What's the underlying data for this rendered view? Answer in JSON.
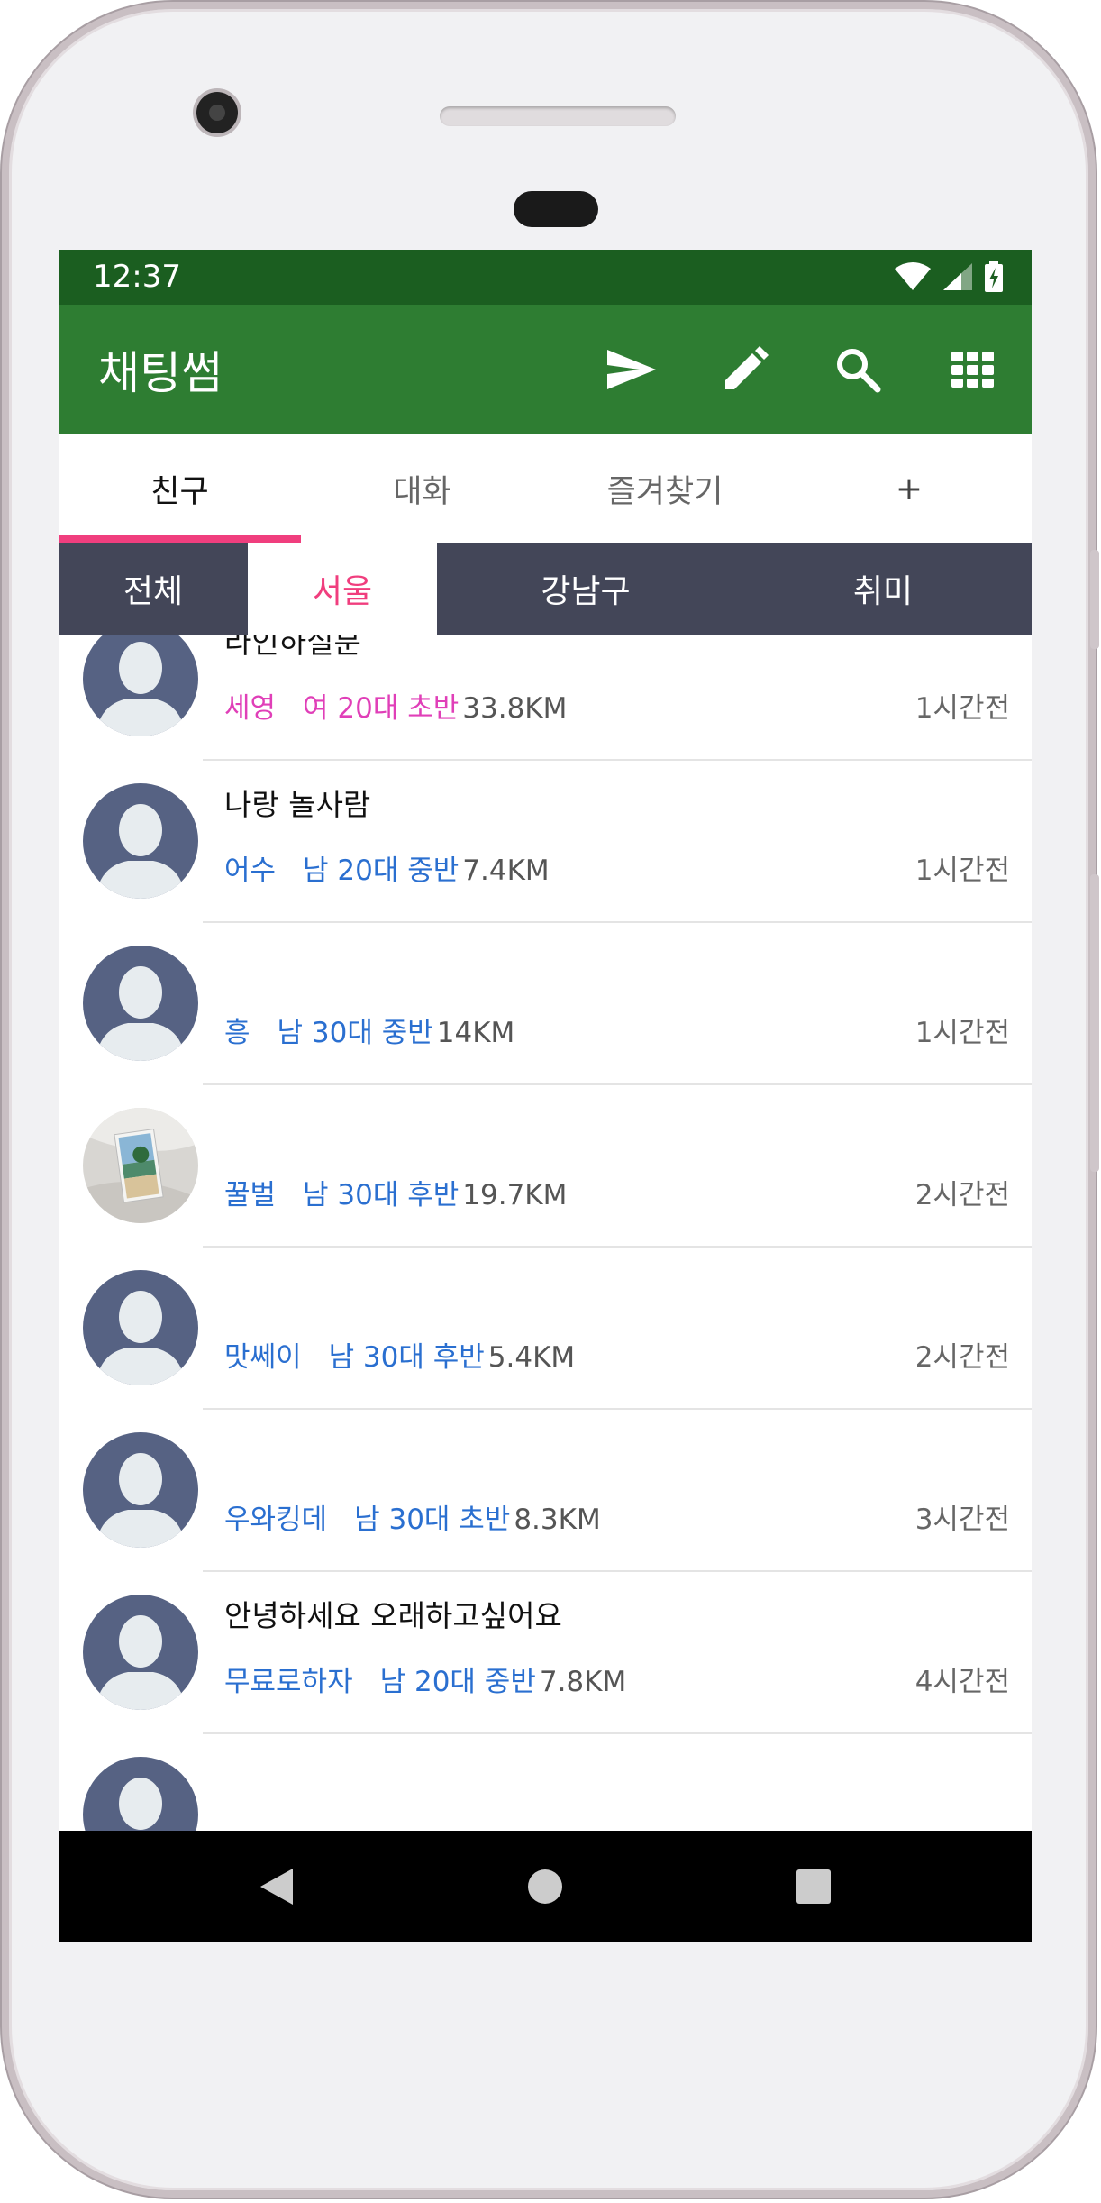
{
  "status_bar": {
    "time": "12:37"
  },
  "app_bar": {
    "title": "채팅썸",
    "actions": [
      "send-icon",
      "edit-icon",
      "search-icon",
      "grid-icon"
    ]
  },
  "tabs": [
    {
      "label": "친구",
      "active": true
    },
    {
      "label": "대화",
      "active": false
    },
    {
      "label": "즐겨찾기",
      "active": false
    },
    {
      "label": "+",
      "active": false
    }
  ],
  "sub_tabs": [
    {
      "label": "전체",
      "active": false
    },
    {
      "label": "서울",
      "active": true
    },
    {
      "label": "강남구",
      "active": false
    },
    {
      "label": "취미",
      "active": false
    }
  ],
  "colors": {
    "status_bar": "#1b5e20",
    "app_bar": "#2e7d32",
    "accent_pink": "#f03e7e",
    "sub_bar": "#434658",
    "female": "#e03fb8",
    "male": "#2a6fd0"
  },
  "users": [
    {
      "title": "라인하실분",
      "nick": "세영",
      "info": "여 20대 초반",
      "distance": "33.8KM",
      "time": "1시간전",
      "gender": "female",
      "avatar": "default"
    },
    {
      "title": "나랑 놀사람",
      "nick": "어수",
      "info": "남 20대 중반",
      "distance": "7.4KM",
      "time": "1시간전",
      "gender": "male",
      "avatar": "default"
    },
    {
      "title": "",
      "nick": "흥",
      "info": "남 30대 중반",
      "distance": "14KM",
      "time": "1시간전",
      "gender": "male",
      "avatar": "default"
    },
    {
      "title": "",
      "nick": "꿀벌",
      "info": "남 30대 후반",
      "distance": "19.7KM",
      "time": "2시간전",
      "gender": "male",
      "avatar": "photo"
    },
    {
      "title": "",
      "nick": "맛쎄이",
      "info": "남 30대 후반",
      "distance": "5.4KM",
      "time": "2시간전",
      "gender": "male",
      "avatar": "default"
    },
    {
      "title": "",
      "nick": "우와킹데",
      "info": "남 30대 초반",
      "distance": "8.3KM",
      "time": "3시간전",
      "gender": "male",
      "avatar": "default"
    },
    {
      "title": "안녕하세요 오래하고싶어요",
      "nick": "무료로하자",
      "info": "남 20대 중반",
      "distance": "7.8KM",
      "time": "4시간전",
      "gender": "male",
      "avatar": "default"
    },
    {
      "title": "",
      "nick": "",
      "info": "",
      "distance": "",
      "time": "",
      "gender": "male",
      "avatar": "default"
    }
  ],
  "nav": [
    "back-icon",
    "home-icon",
    "recents-icon"
  ]
}
